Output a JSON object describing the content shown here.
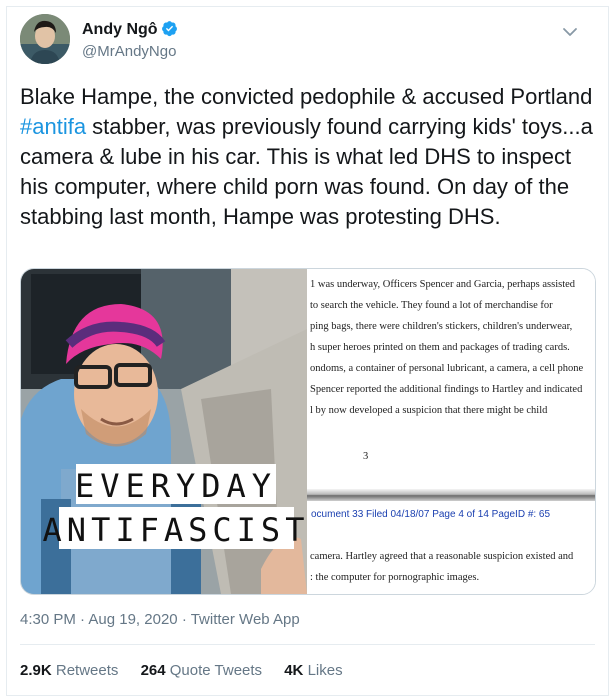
{
  "author": {
    "display_name": "Andy Ngô",
    "handle": "@MrAndyNgo",
    "verified": true
  },
  "tweet": {
    "text_before": "Blake Hampe, the convicted pedophile & accused Portland ",
    "hashtag": "#antifa",
    "text_after": " stabber, was previously found carrying kids' toys...a camera & lube in his car. This is what led DHS to inspect his computer, where child porn was found. On day of the stabbing last month, Hampe was protesting DHS."
  },
  "media": {
    "photo_caption_line1": "EVERYDAY",
    "photo_caption_line2": "ANTIFASCIST",
    "document_lines": [
      "1 was underway, Officers Spencer and Garcia, perhaps assisted",
      "to search the vehicle.  They found a lot of merchandise for",
      "ping bags, there were children's stickers, children's underwear,",
      "h super heroes printed on them and packages of trading cards.",
      "ondoms, a container of personal lubricant, a camera, a cell phone",
      "Spencer reported the additional findings to Hartley and indicated",
      "l by now developed a suspicion that there might be child"
    ],
    "document_page_number": "3",
    "document_footer": "ocument 33    Filed 04/18/07    Page 4 of 14    PageID #: 65",
    "document_lines_2": [
      "camera.  Hartley agreed that a reasonable suspicion existed and",
      ": the computer for pornographic images."
    ]
  },
  "meta": {
    "time": "4:30 PM",
    "date": "Aug 19, 2020",
    "source": "Twitter Web App",
    "separator": "·"
  },
  "stats": {
    "retweets_count": "2.9K",
    "retweets_label": "Retweets",
    "quote_count": "264",
    "quote_label": "Quote Tweets",
    "likes_count": "4K",
    "likes_label": "Likes"
  },
  "colors": {
    "link": "#1b95e0",
    "secondary_text": "#657786",
    "verified_badge": "#1da1f2"
  },
  "icons": [
    "verified-badge-icon",
    "chevron-down-icon"
  ]
}
